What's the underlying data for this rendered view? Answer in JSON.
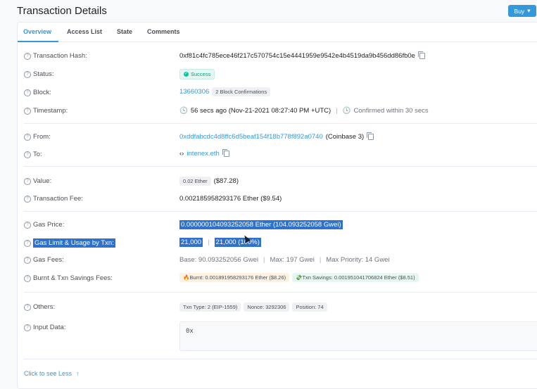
{
  "page": {
    "title": "Transaction Details"
  },
  "header": {
    "buy_label": "Buy",
    "buy_caret": "▾"
  },
  "tabs": [
    {
      "label": "Overview"
    },
    {
      "label": "Access List"
    },
    {
      "label": "State"
    },
    {
      "label": "Comments"
    }
  ],
  "rows": {
    "hash": {
      "label": "Transaction Hash:",
      "value": "0xf81c4fc785ece46f217c570754c15e4441959e9542e4b4519da9b456dd86fb0e"
    },
    "status": {
      "label": "Status:",
      "value": "Success"
    },
    "block": {
      "label": "Block:",
      "value": "13660306",
      "confirmations": "2 Block Confirmations"
    },
    "timestamp": {
      "label": "Timestamp:",
      "value": "56 secs ago (Nov-21-2021 08:27:40 PM +UTC)",
      "confirmed": "Confirmed within 30 secs"
    },
    "from": {
      "label": "From:",
      "value": "0xddfabcdc4d8ffc6d5beaf154f18b778f892a0740",
      "tag": "(Coinbase 3)"
    },
    "to": {
      "label": "To:",
      "value": "intenex.eth"
    },
    "value": {
      "label": "Value:",
      "chip": "0.02 Ether",
      "usd": "($87.28)"
    },
    "fee": {
      "label": "Transaction Fee:",
      "value": "0.002185958293176 Ether ($9.54)"
    },
    "gas_price": {
      "label": "Gas Price:",
      "value": "0.000000104093252058 Ether (104.093252058 Gwei)"
    },
    "gas_limit": {
      "label": "Gas Limit & Usage by Txn:",
      "limit": "21,000",
      "usage": "21,000 (100%)"
    },
    "gas_fees": {
      "label": "Gas Fees:",
      "base": "Base: 90.093252056 Gwei",
      "max": "Max: 197 Gwei",
      "priority": "Max Priority: 14 Gwei"
    },
    "burnt": {
      "label": "Burnt & Txn Savings Fees:",
      "burnt": "🔥Burnt: 0.001891958293176 Ether ($8.26)",
      "savings": "💸Txn Savings: 0.001951041706824 Ether ($8.51)"
    },
    "others": {
      "label": "Others:",
      "txn_type": "Txn Type: 2 (EIP-1559)",
      "nonce": "Nonce: 3292306",
      "position": "Position: 74"
    },
    "input": {
      "label": "Input Data:",
      "value": "0x"
    }
  },
  "footer": {
    "see_less": "Click to see Less",
    "arrow": "↑"
  },
  "colors": {
    "accent": "#3498db",
    "success": "#00c9a7",
    "highlight": "#3071c9"
  },
  "icons": [
    "question-icon",
    "copy-icon",
    "check-circle-icon",
    "clock-icon",
    "contract-icon",
    "chevron-down-icon",
    "arrow-up-icon",
    "mouse-cursor-icon"
  ]
}
